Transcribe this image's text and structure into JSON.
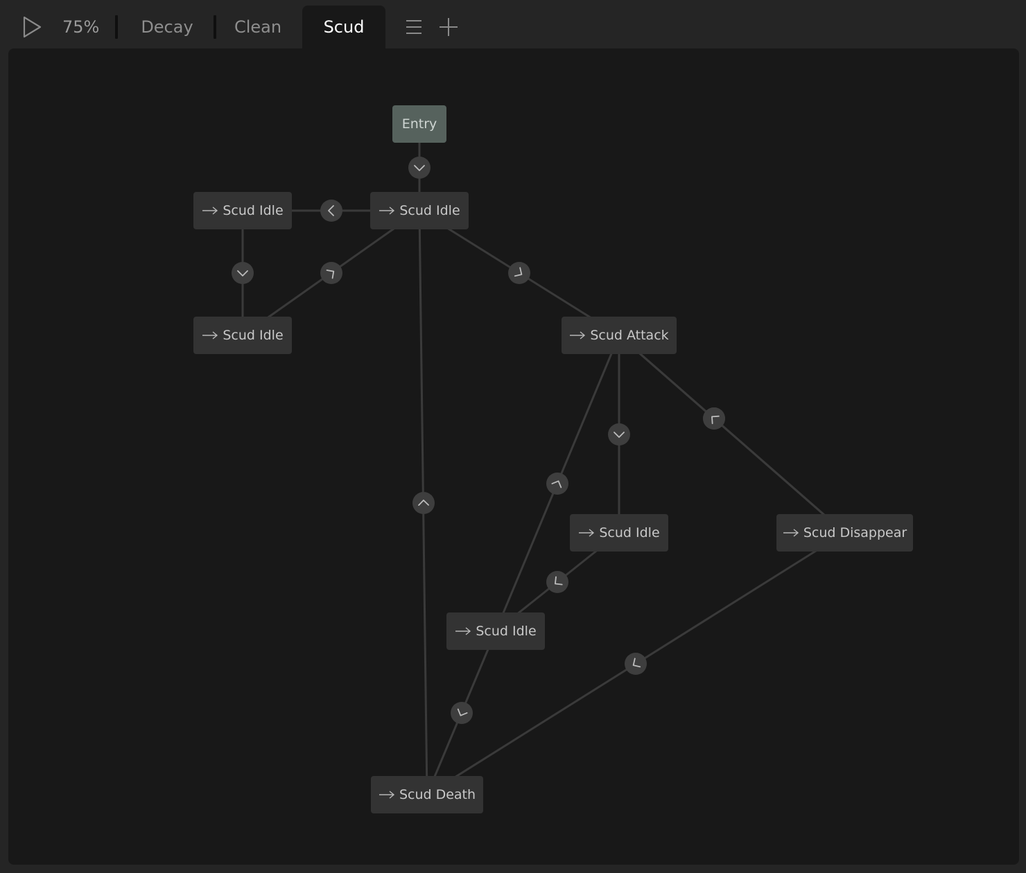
{
  "toolbar": {
    "zoom_label": "75%",
    "tabs": [
      {
        "label": "Decay",
        "active": false
      },
      {
        "label": "Clean",
        "active": false
      },
      {
        "label": "Scud",
        "active": true
      }
    ],
    "icons": [
      "play-icon",
      "menu-icon",
      "plus-icon"
    ]
  },
  "graph": {
    "nodes": [
      {
        "id": "entry",
        "label": "Entry",
        "kind": "entry"
      },
      {
        "id": "idle_main",
        "label": "Scud Idle",
        "kind": "state"
      },
      {
        "id": "idle_left_top",
        "label": "Scud Idle",
        "kind": "state"
      },
      {
        "id": "idle_left_bottom",
        "label": "Scud Idle",
        "kind": "state"
      },
      {
        "id": "attack",
        "label": "Scud Attack",
        "kind": "state"
      },
      {
        "id": "idle_right",
        "label": "Scud Idle",
        "kind": "state"
      },
      {
        "id": "disappear",
        "label": "Scud Disappear",
        "kind": "state"
      },
      {
        "id": "idle_center",
        "label": "Scud Idle",
        "kind": "state"
      },
      {
        "id": "death",
        "label": "Scud Death",
        "kind": "state"
      }
    ],
    "transitions": [
      {
        "from": "entry",
        "to": "idle_main"
      },
      {
        "from": "idle_main",
        "to": "idle_left_top"
      },
      {
        "from": "idle_left_top",
        "to": "idle_left_bottom"
      },
      {
        "from": "idle_left_bottom",
        "to": "idle_main"
      },
      {
        "from": "idle_main",
        "to": "attack"
      },
      {
        "from": "death",
        "to": "idle_main"
      },
      {
        "from": "attack",
        "to": "idle_right"
      },
      {
        "from": "attack",
        "to": "disappear"
      },
      {
        "from": "disappear",
        "to": "attack"
      },
      {
        "from": "idle_right",
        "to": "idle_center"
      },
      {
        "from": "idle_center",
        "to": "attack"
      },
      {
        "from": "idle_center",
        "to": "death"
      },
      {
        "from": "disappear",
        "to": "death"
      }
    ]
  },
  "colors": {
    "background": "#252525",
    "canvas": "#181818",
    "node": "#333333",
    "entry_node": "#56625d",
    "edge": "#3a3a3a",
    "badge": "#3e3e3e",
    "active_tab_text": "#ffffff"
  }
}
